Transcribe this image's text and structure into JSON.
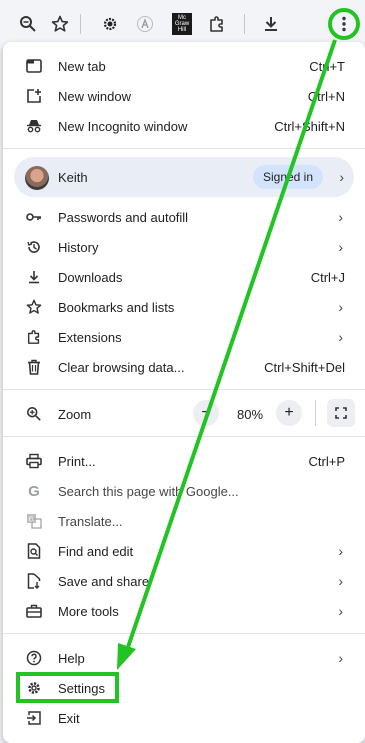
{
  "toolbar": {
    "icons": [
      "zoom-icon",
      "bookmark-star-icon",
      "extension-sun-icon",
      "extension-script-icon",
      "mcgraw-hill-extension-icon",
      "extensions-puzzle-icon",
      "download-icon",
      "more-menu-icon"
    ],
    "mcgraw_text": "Mc Graw Hill"
  },
  "menu": {
    "new_tab": {
      "label": "New tab",
      "shortcut": "Ctrl+T"
    },
    "new_window": {
      "label": "New window",
      "shortcut": "Ctrl+N"
    },
    "incognito": {
      "label": "New Incognito window",
      "shortcut": "Ctrl+Shift+N"
    },
    "profile": {
      "name": "Keith",
      "badge": "Signed in"
    },
    "passwords": {
      "label": "Passwords and autofill"
    },
    "history": {
      "label": "History"
    },
    "downloads": {
      "label": "Downloads",
      "shortcut": "Ctrl+J"
    },
    "bookmarks": {
      "label": "Bookmarks and lists"
    },
    "extensions": {
      "label": "Extensions"
    },
    "clear": {
      "label": "Clear browsing data...",
      "shortcut": "Ctrl+Shift+Del"
    },
    "zoom": {
      "label": "Zoom",
      "value": "80%",
      "minus": "−",
      "plus": "+"
    },
    "print": {
      "label": "Print...",
      "shortcut": "Ctrl+P"
    },
    "search_page": {
      "label": "Search this page with Google..."
    },
    "translate": {
      "label": "Translate..."
    },
    "find_edit": {
      "label": "Find and edit"
    },
    "save_share": {
      "label": "Save and share"
    },
    "more_tools": {
      "label": "More tools"
    },
    "help": {
      "label": "Help"
    },
    "settings": {
      "label": "Settings"
    },
    "exit": {
      "label": "Exit"
    }
  },
  "colors": {
    "annotation": "#22c322",
    "badge": "#d3e3fd",
    "profile_bg": "#e9eef6"
  }
}
